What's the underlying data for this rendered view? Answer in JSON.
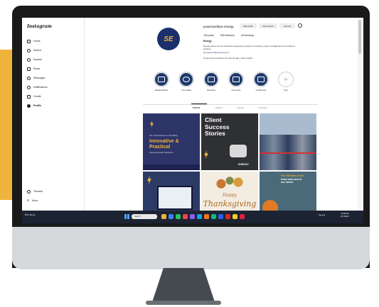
{
  "sidebar": {
    "logo": "Instagram",
    "items": [
      {
        "label": "Home"
      },
      {
        "label": "Search"
      },
      {
        "label": "Explore"
      },
      {
        "label": "Reels"
      },
      {
        "label": "Messages"
      },
      {
        "label": "Notifications"
      },
      {
        "label": "Create"
      },
      {
        "label": "Profile"
      }
    ],
    "bottom": [
      {
        "label": "Threads"
      },
      {
        "label": "More"
      }
    ]
  },
  "profile": {
    "avatar_text": "SE",
    "username": "powerandlyse.energy",
    "buttons": {
      "edit": "Edit profile",
      "archive": "View archive",
      "tools": "Ad tools"
    },
    "stats": {
      "posts": "106 posts",
      "followers": "303 followers",
      "following": "18 following"
    },
    "bio_name": "Energy",
    "bio_lines": [
      "Energy-driven firm for electrical engineering, business consulting, project management & recruitment",
      "services.",
      "@ powerandlyseenergy.com"
    ],
    "bio_link": "19 accounts reached in the last 30 days. View insights"
  },
  "highlights": [
    {
      "label": "Related Brands"
    },
    {
      "label": "Core Values"
    },
    {
      "label": "Recruiting"
    },
    {
      "label": "Community"
    },
    {
      "label": "Conferences"
    },
    {
      "label": "New"
    }
  ],
  "tabs": [
    "POSTS",
    "REELS",
    "SAVED",
    "TAGGED"
  ],
  "posts": {
    "p1": {
      "tag": "Our Commitment to Providing",
      "headline_1": "Innovative &",
      "headline_2": "Practical",
      "subtitle": "Client-Focused Solutions"
    },
    "p2": {
      "headline_1": "Client",
      "headline_2": "Success",
      "headline_3": "Stories",
      "brand": "ENERGY"
    },
    "p4": {},
    "p5": {
      "line_1": "Happy",
      "line_2": "Thanksgiving"
    },
    "p6": {
      "line_1": "The SE team is the",
      "line_2": "heart and soul of",
      "line_3": "our brand."
    }
  },
  "taskbar": {
    "weather": "66°F Sunny",
    "search": "Search",
    "time": "12:00 PM",
    "date": "1/17/2024"
  },
  "colors": {
    "accent": "#f0b43c",
    "navy": "#1b2f6b",
    "taskbar": "#1c2333"
  }
}
